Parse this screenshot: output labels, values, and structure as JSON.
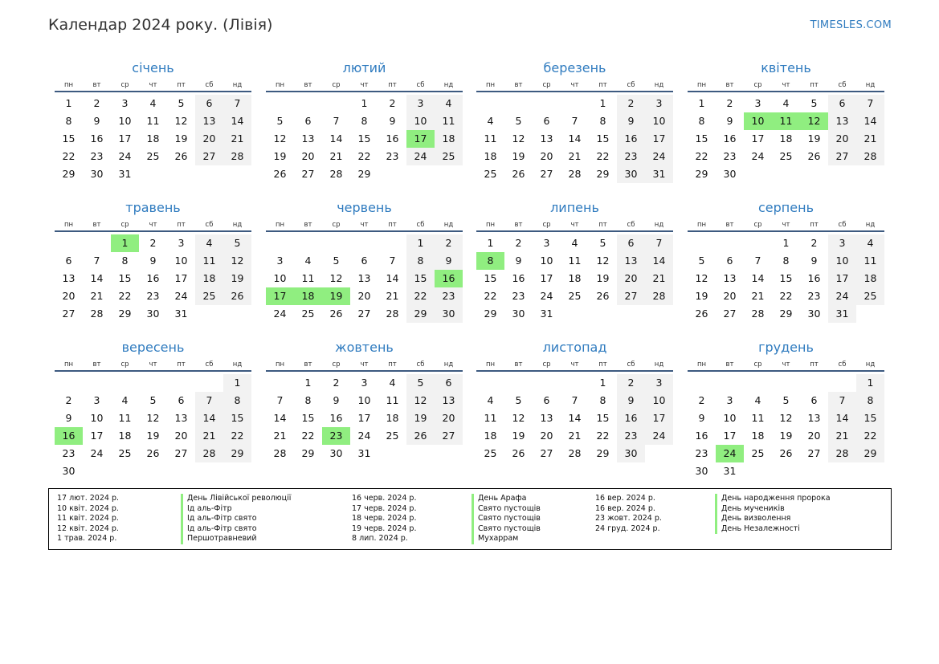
{
  "title": "Календар 2024 року. (Лівія)",
  "brand": "TIMESLES.COM",
  "weekdays": [
    "пн",
    "вт",
    "ср",
    "чт",
    "пт",
    "сб",
    "нд"
  ],
  "months": [
    {
      "name": "січень",
      "offset": 0,
      "days": 31,
      "holidays": []
    },
    {
      "name": "лютий",
      "offset": 3,
      "days": 29,
      "holidays": [
        17
      ]
    },
    {
      "name": "березень",
      "offset": 4,
      "days": 31,
      "holidays": []
    },
    {
      "name": "квітень",
      "offset": 0,
      "days": 30,
      "holidays": [
        10,
        11,
        12
      ]
    },
    {
      "name": "травень",
      "offset": 2,
      "days": 31,
      "holidays": [
        1
      ]
    },
    {
      "name": "червень",
      "offset": 5,
      "days": 30,
      "holidays": [
        16,
        17,
        18,
        19
      ]
    },
    {
      "name": "липень",
      "offset": 0,
      "days": 31,
      "holidays": [
        8
      ]
    },
    {
      "name": "серпень",
      "offset": 3,
      "days": 31,
      "holidays": []
    },
    {
      "name": "вересень",
      "offset": 6,
      "days": 30,
      "holidays": [
        16
      ]
    },
    {
      "name": "жовтень",
      "offset": 1,
      "days": 31,
      "holidays": [
        23
      ]
    },
    {
      "name": "листопад",
      "offset": 4,
      "days": 30,
      "holidays": []
    },
    {
      "name": "грудень",
      "offset": 6,
      "days": 31,
      "holidays": [
        24
      ]
    }
  ],
  "legend": [
    [
      {
        "date": "17 лют. 2024 р.",
        "name": "День Лівійської революції"
      },
      {
        "date": "10 квіт. 2024 р.",
        "name": "Ід аль-Фітр"
      },
      {
        "date": "11 квіт. 2024 р.",
        "name": "Ід аль-Фітр свято"
      },
      {
        "date": "12 квіт. 2024 р.",
        "name": "Ід аль-Фітр свято"
      },
      {
        "date": "1 трав. 2024 р.",
        "name": "Першотравневий"
      }
    ],
    [
      {
        "date": "16 черв. 2024 р.",
        "name": "День Арафа"
      },
      {
        "date": "17 черв. 2024 р.",
        "name": "Свято пустощів"
      },
      {
        "date": "18 черв. 2024 р.",
        "name": "Свято пустощів"
      },
      {
        "date": "19 черв. 2024 р.",
        "name": "Свято пустощів"
      },
      {
        "date": "8 лип. 2024 р.",
        "name": "Мухаррам"
      }
    ],
    [
      {
        "date": "16 вер. 2024 р.",
        "name": "День народження пророка"
      },
      {
        "date": "16 вер. 2024 р.",
        "name": "День мучеників"
      },
      {
        "date": "23 жовт. 2024 р.",
        "name": "День визволення"
      },
      {
        "date": "24 груд. 2024 р.",
        "name": "День Незалежності"
      }
    ]
  ]
}
